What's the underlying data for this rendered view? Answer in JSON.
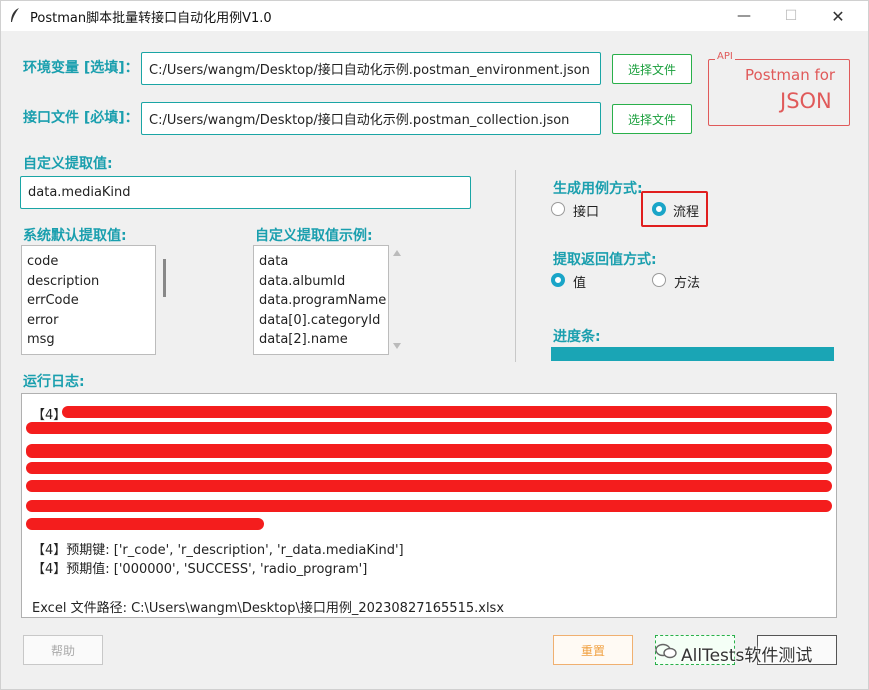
{
  "window": {
    "title": "Postman脚本批量转接口自动化用例V1.0",
    "minimize": "—",
    "maximize": "☐",
    "close": "✕"
  },
  "env": {
    "label": "环境变量 [选填]：",
    "value": "C:/Users/wangm/Desktop/接口自动化示例.postman_environment.json",
    "button": "选择文件"
  },
  "api_file": {
    "label": "接口文件 [必填]：",
    "value": "C:/Users/wangm/Desktop/接口自动化示例.postman_collection.json",
    "button": "选择文件"
  },
  "api_box": {
    "legend": "API",
    "line1": "Postman for",
    "line2": "JSON"
  },
  "custom_extract": {
    "label": "自定义提取值:",
    "value": "data.mediaKind"
  },
  "default_extract": {
    "label": "系统默认提取值:",
    "items": [
      "code",
      "description",
      "errCode",
      "error",
      "msg"
    ]
  },
  "custom_examples": {
    "label": "自定义提取值示例:",
    "items": [
      "data",
      "data.albumId",
      "data.programName",
      "data[0].categoryId",
      "data[2].name"
    ]
  },
  "gen_mode": {
    "label": "生成用例方式:",
    "options": [
      "接口",
      "流程"
    ],
    "selected": "流程"
  },
  "return_mode": {
    "label": "提取返回值方式:",
    "options": [
      "值",
      "方法"
    ],
    "selected": "值"
  },
  "progress": {
    "label": "进度条:",
    "value": 1.0
  },
  "log": {
    "label": "运行日志:",
    "lines": {
      "first_prefix": "【4】",
      "keys": "【4】预期键: ['r_code', 'r_description', 'r_data.mediaKind']",
      "values": "【4】预期值: ['000000', 'SUCCESS', 'radio_program']",
      "path": "Excel 文件路径: C:\\Users\\wangm\\Desktop\\接口用例_20230827165515.xlsx"
    }
  },
  "footer": {
    "help": "帮助",
    "reset": "重置",
    "watermark": "AllTests软件测试"
  },
  "colors": {
    "accent": "#1a9fae",
    "green_button": "#29b04a",
    "highlight_box": "#e01e1e",
    "progress": "#1aa5b5",
    "reset": "#f0a040"
  }
}
